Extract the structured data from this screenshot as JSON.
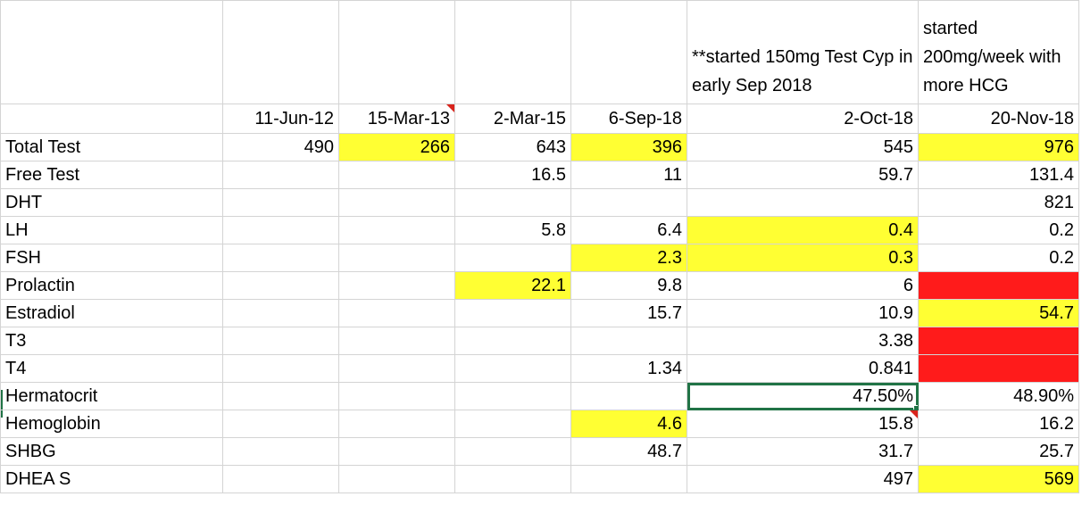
{
  "notes": {
    "oct18": "**started 150mg Test Cyp in early Sep 2018",
    "nov18": "started 200mg/week with more HCG"
  },
  "dates": [
    "11-Jun-12",
    "15-Mar-13",
    "2-Mar-15",
    "6-Sep-18",
    "2-Oct-18",
    "20-Nov-18"
  ],
  "rows": [
    {
      "label": "Total Test",
      "values": [
        "490",
        "266",
        "643",
        "396",
        "545",
        "976"
      ]
    },
    {
      "label": "Free Test",
      "values": [
        "",
        "",
        "16.5",
        "11",
        "59.7",
        "131.4"
      ]
    },
    {
      "label": "DHT",
      "values": [
        "",
        "",
        "",
        "",
        "",
        "821"
      ]
    },
    {
      "label": "LH",
      "values": [
        "",
        "",
        "5.8",
        "6.4",
        "0.4",
        "0.2"
      ]
    },
    {
      "label": "FSH",
      "values": [
        "",
        "",
        "",
        "2.3",
        "0.3",
        "0.2"
      ]
    },
    {
      "label": "Prolactin",
      "values": [
        "",
        "",
        "22.1",
        "9.8",
        "6",
        ""
      ]
    },
    {
      "label": "Estradiol",
      "values": [
        "",
        "",
        "",
        "15.7",
        "10.9",
        "54.7"
      ]
    },
    {
      "label": "T3",
      "values": [
        "",
        "",
        "",
        "",
        "3.38",
        ""
      ]
    },
    {
      "label": "T4",
      "values": [
        "",
        "",
        "",
        "1.34",
        "0.841",
        ""
      ]
    },
    {
      "label": "Hermatocrit",
      "values": [
        "",
        "",
        "",
        "",
        "47.50%",
        "48.90%"
      ]
    },
    {
      "label": "Hemoglobin",
      "values": [
        "",
        "",
        "",
        "4.6",
        "15.8",
        "16.2"
      ]
    },
    {
      "label": "SHBG",
      "values": [
        "",
        "",
        "",
        "48.7",
        "31.7",
        "25.7"
      ]
    },
    {
      "label": "DHEA S",
      "values": [
        "",
        "",
        "",
        "",
        "497",
        "569"
      ]
    }
  ],
  "colors": {
    "highlight_yellow": "#ffff33",
    "highlight_red": "#ff1b1b",
    "selection_green": "#217346",
    "comment_red": "#d9241c"
  }
}
